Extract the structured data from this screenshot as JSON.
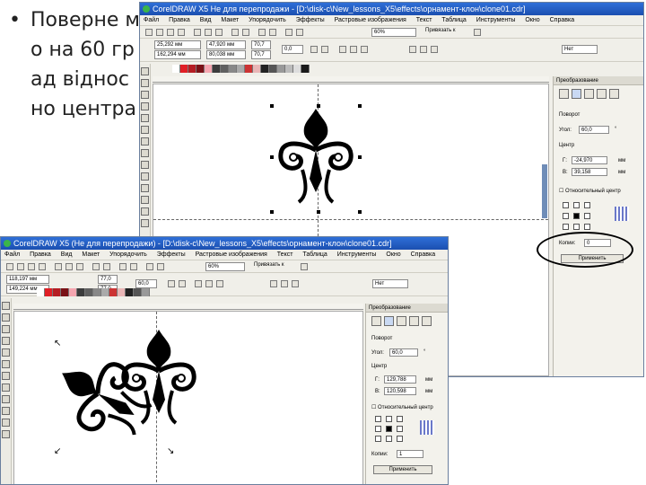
{
  "slide": {
    "bullet": "•",
    "text": "Поверне мо на 60 град відносно центра"
  },
  "back_window": {
    "title": "CorelDRAW X5 Не для перепродажи - [D:\\disk-c\\New_lessons_X5\\effects\\орнамент-клон\\clone01.cdr]",
    "menu": [
      "Файл",
      "Правка",
      "Вид",
      "Макет",
      "Упорядочить",
      "Эффекты",
      "Растровые изображения",
      "Текст",
      "Таблица",
      "Инструменты",
      "Окно",
      "Справка"
    ],
    "zoom": "60%",
    "snap_label": "Привязать к",
    "x_field": "25,292 мм",
    "y_field": "162,294 мм",
    "w_field": "47,920 мм",
    "h_field": "80,038 мм",
    "scale_w": "70,7",
    "scale_h": "70,7",
    "angle": "0,0",
    "outline": "Нет"
  },
  "front_window": {
    "title": "CorelDRAW X5 (Не для перепродажи) - [D:\\disk-c\\New_lessons_X5\\effects\\орнамент-клон\\clone01.cdr]",
    "menu": [
      "Файл",
      "Правка",
      "Вид",
      "Макет",
      "Упорядочить",
      "Эффекты",
      "Растровые изображения",
      "Текст",
      "Таблица",
      "Инструменты",
      "Окно",
      "Справка"
    ],
    "zoom": "60%",
    "snap_label": "Привязать к",
    "x_field": "118,197 мм",
    "y_field": "149,224 мм",
    "w_field": "77,0",
    "h_field": "77,0",
    "angle": "60,0",
    "outline": "Нет"
  },
  "docker_back": {
    "title": "Преобразование",
    "section": "Поворот",
    "angle_label": "Угол:",
    "angle_value": "60,0",
    "unit_deg": "°",
    "center_label": "Центр",
    "cx_label": "Г:",
    "cx_value": "-24,970",
    "cy_label": "В:",
    "cy_value": "39,158",
    "unit_mm": "мм",
    "relative_label": "Относительный центр",
    "copies_label": "Копии:",
    "copies_value": "0",
    "apply_label": "Применить"
  },
  "docker_front": {
    "title": "Преобразование",
    "section": "Поворот",
    "angle_label": "Угол:",
    "angle_value": "60,0",
    "unit_deg": "°",
    "center_label": "Центр",
    "cx_label": "Г:",
    "cx_value": "129,788",
    "cy_label": "В:",
    "cy_value": "120,598",
    "unit_mm": "мм",
    "relative_label": "Относительный центр",
    "copies_label": "Копии:",
    "copies_value": "1",
    "apply_label": "Применить"
  },
  "colors": {
    "titlebar": "#2f6fd8",
    "window_bg": "#f0efe9",
    "ornament": "#000000"
  }
}
